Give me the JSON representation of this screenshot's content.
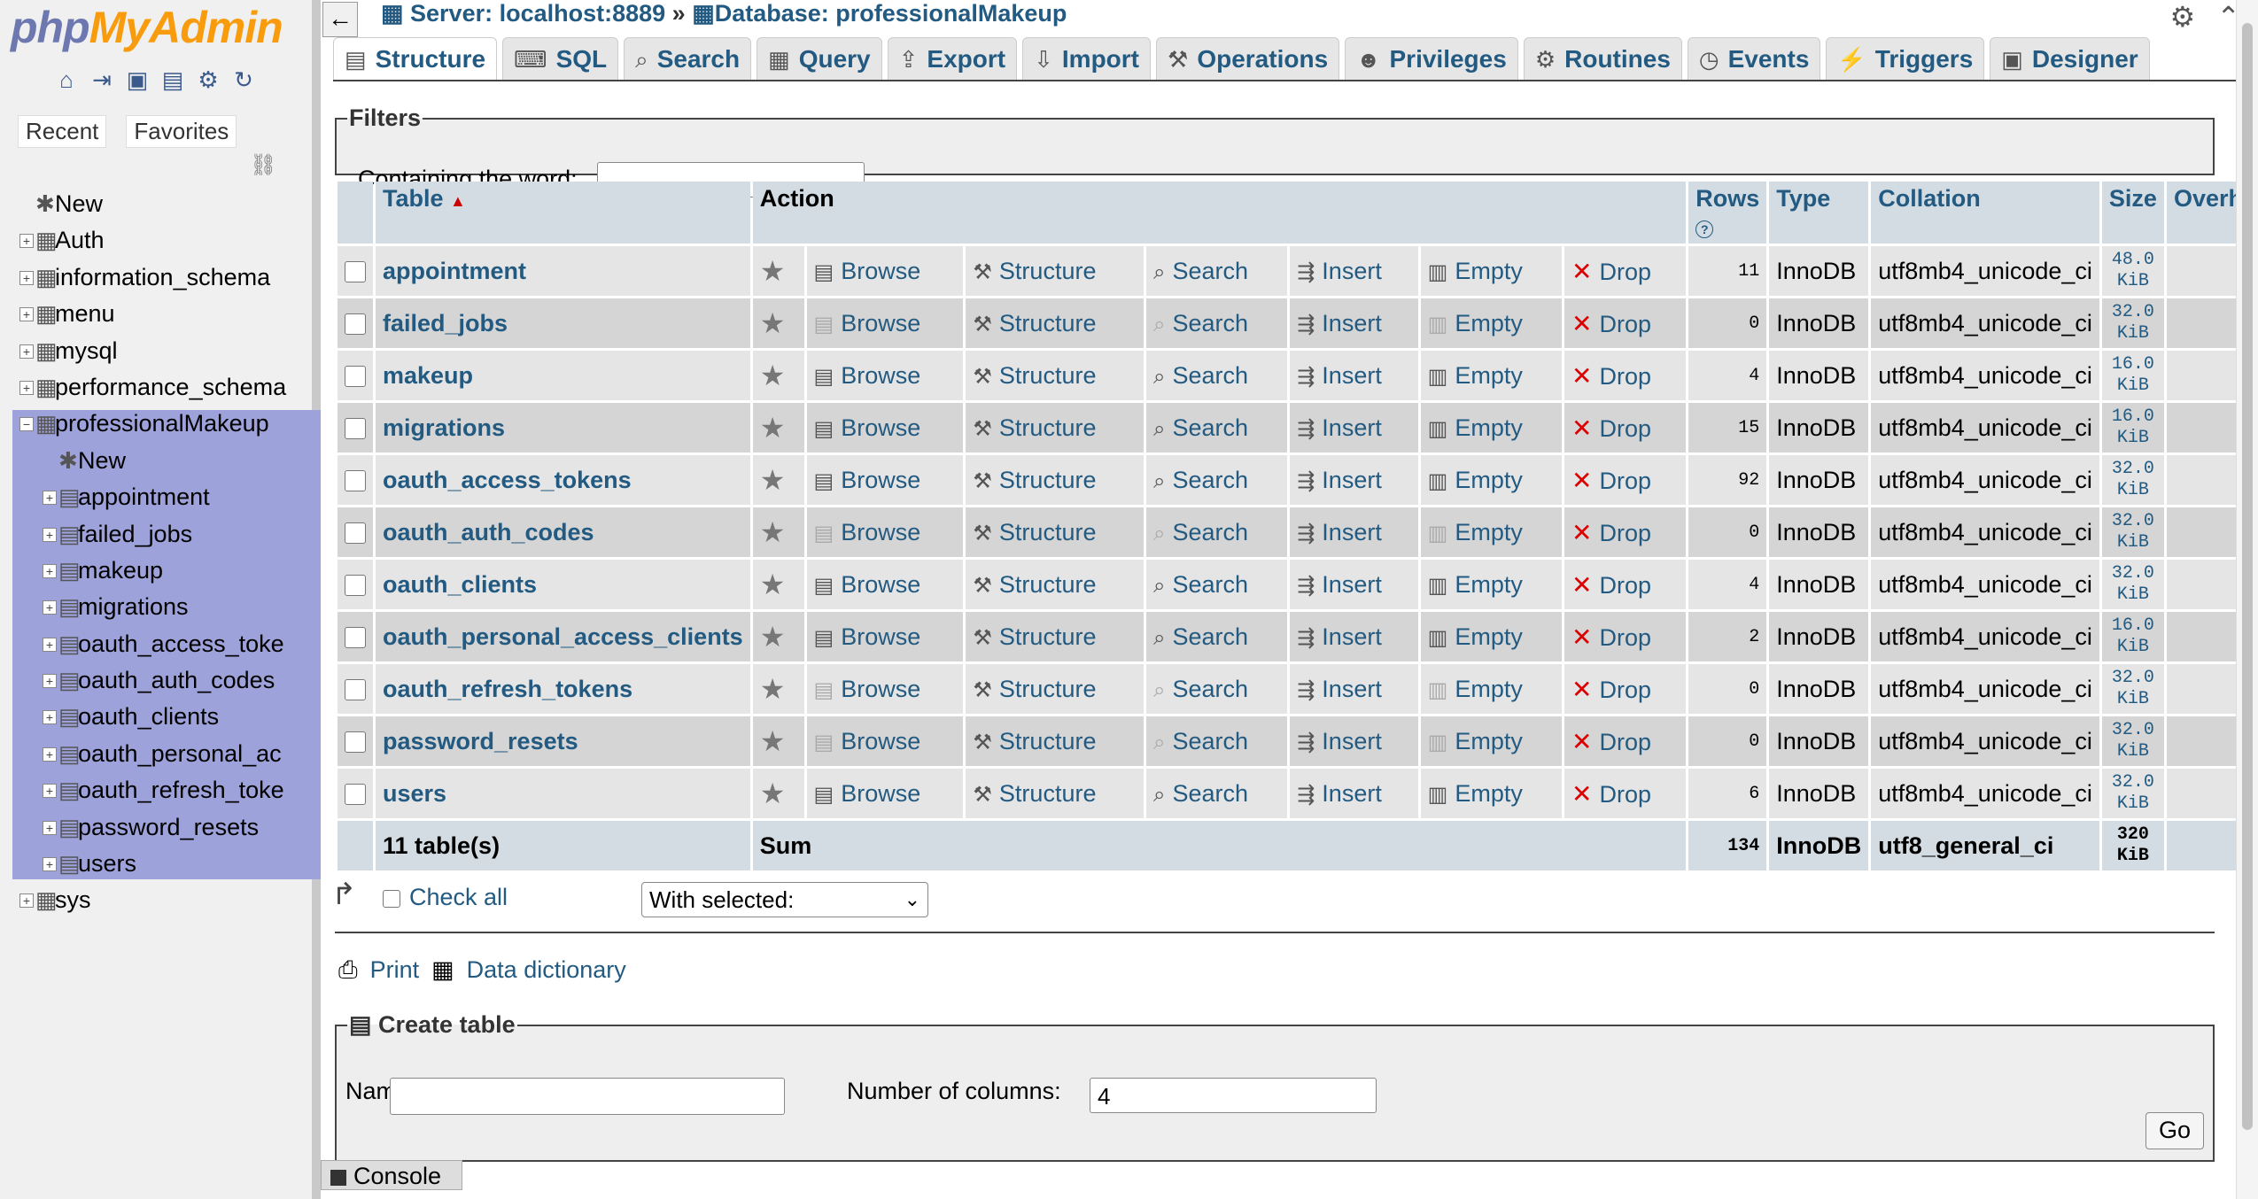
{
  "app": {
    "logo_part1": "php",
    "logo_part2": "MyAdmin"
  },
  "sidebar": {
    "recent": "Recent",
    "favorites": "Favorites",
    "tree": [
      {
        "label": "New",
        "level": 0,
        "icon": "new-icon"
      },
      {
        "label": "Auth",
        "level": 0
      },
      {
        "label": "information_schema",
        "level": 0
      },
      {
        "label": "menu",
        "level": 0
      },
      {
        "label": "mysql",
        "level": 0
      },
      {
        "label": "performance_schema",
        "level": 0
      },
      {
        "label": "professionalMakeup",
        "level": 0,
        "expanded": true
      },
      {
        "label": "New",
        "level": 1
      },
      {
        "label": "appointment",
        "level": 1
      },
      {
        "label": "failed_jobs",
        "level": 1
      },
      {
        "label": "makeup",
        "level": 1
      },
      {
        "label": "migrations",
        "level": 1
      },
      {
        "label": "oauth_access_toke",
        "level": 1
      },
      {
        "label": "oauth_auth_codes",
        "level": 1
      },
      {
        "label": "oauth_clients",
        "level": 1
      },
      {
        "label": "oauth_personal_ac",
        "level": 1
      },
      {
        "label": "oauth_refresh_toke",
        "level": 1
      },
      {
        "label": "password_resets",
        "level": 1
      },
      {
        "label": "users",
        "level": 1
      },
      {
        "label": "sys",
        "level": 0
      }
    ]
  },
  "breadcrumb": {
    "server": "Server: localhost:8889",
    "separator": "»",
    "database": "Database: professionalMakeup"
  },
  "tabs": [
    "Structure",
    "SQL",
    "Search",
    "Query",
    "Export",
    "Import",
    "Operations",
    "Privileges",
    "Routines",
    "Events",
    "Triggers",
    "Designer"
  ],
  "filters": {
    "legend": "Filters",
    "label": "Containing the word:",
    "value": ""
  },
  "table": {
    "headers": {
      "table": "Table",
      "sort_indicator": "▲",
      "action": "Action",
      "rows": "Rows",
      "rows_help": "?",
      "type": "Type",
      "collation": "Collation",
      "size": "Size",
      "overhead": "Overhe"
    },
    "actions": {
      "browse": "Browse",
      "structure": "Structure",
      "search": "Search",
      "insert": "Insert",
      "empty": "Empty",
      "drop": "Drop"
    },
    "rows": [
      {
        "name": "appointment",
        "rows": "11",
        "type": "InnoDB",
        "collation": "utf8mb4_unicode_ci",
        "size": "48.0",
        "unit": "KiB",
        "has_data": true
      },
      {
        "name": "failed_jobs",
        "rows": "0",
        "type": "InnoDB",
        "collation": "utf8mb4_unicode_ci",
        "size": "32.0",
        "unit": "KiB",
        "has_data": false
      },
      {
        "name": "makeup",
        "rows": "4",
        "type": "InnoDB",
        "collation": "utf8mb4_unicode_ci",
        "size": "16.0",
        "unit": "KiB",
        "has_data": true
      },
      {
        "name": "migrations",
        "rows": "15",
        "type": "InnoDB",
        "collation": "utf8mb4_unicode_ci",
        "size": "16.0",
        "unit": "KiB",
        "has_data": true
      },
      {
        "name": "oauth_access_tokens",
        "rows": "92",
        "type": "InnoDB",
        "collation": "utf8mb4_unicode_ci",
        "size": "32.0",
        "unit": "KiB",
        "has_data": true
      },
      {
        "name": "oauth_auth_codes",
        "rows": "0",
        "type": "InnoDB",
        "collation": "utf8mb4_unicode_ci",
        "size": "32.0",
        "unit": "KiB",
        "has_data": false
      },
      {
        "name": "oauth_clients",
        "rows": "4",
        "type": "InnoDB",
        "collation": "utf8mb4_unicode_ci",
        "size": "32.0",
        "unit": "KiB",
        "has_data": true
      },
      {
        "name": "oauth_personal_access_clients",
        "rows": "2",
        "type": "InnoDB",
        "collation": "utf8mb4_unicode_ci",
        "size": "16.0",
        "unit": "KiB",
        "has_data": true
      },
      {
        "name": "oauth_refresh_tokens",
        "rows": "0",
        "type": "InnoDB",
        "collation": "utf8mb4_unicode_ci",
        "size": "32.0",
        "unit": "KiB",
        "has_data": false
      },
      {
        "name": "password_resets",
        "rows": "0",
        "type": "InnoDB",
        "collation": "utf8mb4_unicode_ci",
        "size": "32.0",
        "unit": "KiB",
        "has_data": false
      },
      {
        "name": "users",
        "rows": "6",
        "type": "InnoDB",
        "collation": "utf8mb4_unicode_ci",
        "size": "32.0",
        "unit": "KiB",
        "has_data": true
      }
    ],
    "footer": {
      "count": "11 table(s)",
      "sum": "Sum",
      "rows": "134",
      "type": "InnoDB",
      "collation": "utf8_general_ci",
      "size": "320",
      "unit": "KiB"
    }
  },
  "bulk": {
    "check_all": "Check all",
    "with_selected": "With selected:"
  },
  "links": {
    "print": "Print",
    "data_dictionary": "Data dictionary"
  },
  "create_table": {
    "legend": "Create table",
    "name_label": "Name:",
    "name_value": "",
    "columns_label": "Number of columns:",
    "columns_value": "4",
    "go": "Go"
  },
  "console": "Console",
  "colors": {
    "link": "#235a81",
    "tree_highlight": "#9ea2da",
    "header_bg": "#d3dce3",
    "drop": "#dd0000"
  }
}
